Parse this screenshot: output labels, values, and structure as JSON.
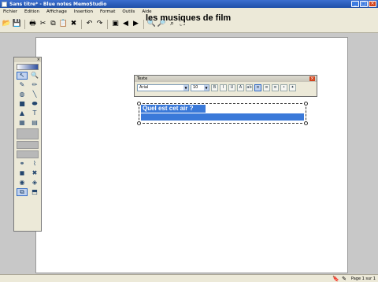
{
  "window": {
    "title": "Sans titre* - Blue notes MemoStudio",
    "controls": [
      "_",
      "□",
      "×"
    ]
  },
  "menu": [
    "Fichier",
    "Edition",
    "Affichage",
    "Insertion",
    "Format",
    "Outils",
    "Aide"
  ],
  "toolbar": {
    "icons": [
      {
        "name": "open-icon",
        "glyph": "📂"
      },
      {
        "name": "save-icon",
        "glyph": "💾"
      },
      {
        "name": "print-icon",
        "glyph": "🖶"
      },
      {
        "name": "cut-icon",
        "glyph": "✂"
      },
      {
        "name": "copy-icon",
        "glyph": "⧉"
      },
      {
        "name": "paste-icon",
        "glyph": "📋"
      },
      {
        "name": "delete-icon",
        "glyph": "✖"
      },
      {
        "name": "undo-icon",
        "glyph": "↶"
      },
      {
        "name": "redo-icon",
        "glyph": "↷"
      },
      {
        "name": "insert-page-icon",
        "glyph": "▣"
      },
      {
        "name": "back-icon",
        "glyph": "◀"
      },
      {
        "name": "forward-icon",
        "glyph": "▶"
      },
      {
        "name": "zoom-in-icon",
        "glyph": "🔍"
      },
      {
        "name": "zoom-out-icon",
        "glyph": "🔎"
      },
      {
        "name": "zoom-fit-icon",
        "glyph": "⌕"
      },
      {
        "name": "fullscreen-icon",
        "glyph": "⛶"
      }
    ]
  },
  "page": {
    "title": "les musiques de film",
    "text_object": "Quel est cet air ?"
  },
  "text_window": {
    "title": "Texte",
    "font": "Arial",
    "size": "10",
    "buttons": [
      {
        "name": "bold-button",
        "label": "B",
        "active": false
      },
      {
        "name": "italic-button",
        "label": "I",
        "active": false
      },
      {
        "name": "underline-button",
        "label": "U",
        "active": false
      },
      {
        "name": "color-button",
        "label": "A",
        "active": false
      },
      {
        "name": "highlight-button",
        "label": "ab",
        "active": false
      },
      {
        "name": "align-left-button",
        "label": "≡",
        "active": true
      },
      {
        "name": "align-center-button",
        "label": "≡",
        "active": false
      },
      {
        "name": "align-right-button",
        "label": "≡",
        "active": false
      },
      {
        "name": "bullets-button",
        "label": "•",
        "active": false
      },
      {
        "name": "effects-button",
        "label": "✦",
        "active": false
      }
    ]
  },
  "palette": {
    "tools": [
      {
        "name": "select-tool",
        "glyph": "↖",
        "selected": true
      },
      {
        "name": "zoom-tool",
        "glyph": "🔍",
        "selected": false
      },
      {
        "name": "pen-tool",
        "glyph": "✎",
        "selected": false
      },
      {
        "name": "marker-tool",
        "glyph": "✏",
        "selected": false
      },
      {
        "name": "eraser-tool",
        "glyph": "◍",
        "selected": false
      },
      {
        "name": "line-tool",
        "glyph": "╲",
        "selected": false
      },
      {
        "name": "rectangle-tool",
        "glyph": "■",
        "selected": false
      },
      {
        "name": "ellipse-tool",
        "glyph": "⬬",
        "selected": false
      },
      {
        "name": "triangle-tool",
        "glyph": "▲",
        "selected": false
      },
      {
        "name": "text-tool",
        "glyph": "T",
        "selected": false
      },
      {
        "name": "image-tool",
        "glyph": "▦",
        "selected": false
      },
      {
        "name": "media-tool",
        "glyph": "▤",
        "selected": false
      }
    ],
    "tools_bottom": [
      {
        "name": "link-tool",
        "glyph": "⚭",
        "selected": false
      },
      {
        "name": "chain-tool",
        "glyph": "⌇",
        "selected": false
      },
      {
        "name": "record-tool",
        "glyph": "◼",
        "selected": false
      },
      {
        "name": "close-tool",
        "glyph": "✖",
        "selected": false
      },
      {
        "name": "audio-tool",
        "glyph": "◉",
        "selected": false
      },
      {
        "name": "shield-tool",
        "glyph": "◈",
        "selected": false
      },
      {
        "name": "group-tool",
        "glyph": "⧉",
        "selected": true
      },
      {
        "name": "layer-tool",
        "glyph": "⬒",
        "selected": false
      }
    ]
  },
  "status": {
    "page_indicator": "Page 1 sur 1"
  }
}
